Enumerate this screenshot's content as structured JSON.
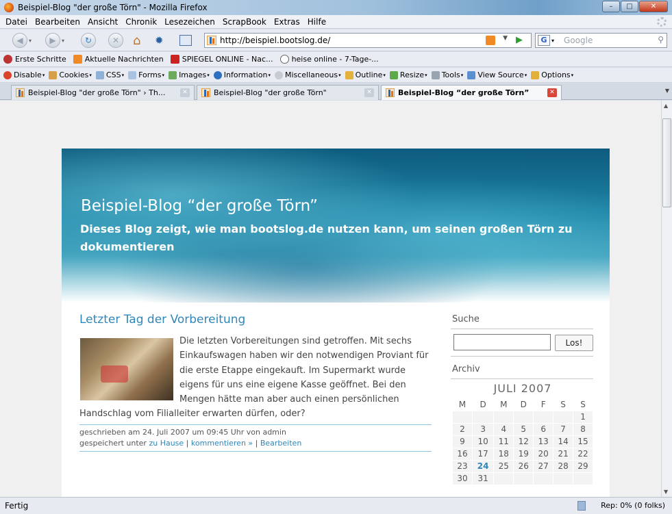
{
  "window": {
    "title": "Beispiel-Blog \"der große Törn\" - Mozilla Firefox"
  },
  "menu": [
    "Datei",
    "Bearbeiten",
    "Ansicht",
    "Chronik",
    "Lesezeichen",
    "ScrapBook",
    "Extras",
    "Hilfe"
  ],
  "nav": {
    "url": "http://beispiel.bootslog.de/",
    "search_placeholder": "Google"
  },
  "bookmarks": [
    "Erste Schritte",
    "Aktuelle Nachrichten",
    "SPIEGEL ONLINE - Nac...",
    "heise online - 7-Tage-..."
  ],
  "devtools": [
    "Disable",
    "Cookies",
    "CSS",
    "Forms",
    "Images",
    "Information",
    "Miscellaneous",
    "Outline",
    "Resize",
    "Tools",
    "View Source",
    "Options"
  ],
  "tabs": [
    {
      "label": "Beispiel-Blog \"der große Törn\" › Th..."
    },
    {
      "label": "Beispiel-Blog \"der große Törn\""
    },
    {
      "label": "Beispiel-Blog “der große Törn”"
    }
  ],
  "blog": {
    "title": "Beispiel-Blog “der große Törn”",
    "description": "Dieses Blog zeigt, wie man bootslog.de nutzen kann, um seinen großen Törn zu dokumentieren"
  },
  "post": {
    "title": "Letzter Tag der Vorbereitung",
    "body": "Die letzten Vorbereitungen sind getroffen. Mit sechs Einkaufswagen haben wir den notwendigen Proviant für die erste Etappe eingekauft. Im Supermarkt wurde eigens für uns eine eigene Kasse geöffnet. Bei den Mengen hätte man aber auch einen persönlichen Handschlag vom Filialleiter erwarten dürfen, oder?",
    "meta_written": "geschrieben am 24. Juli 2007 um 09:45 Uhr von admin",
    "meta_saved_prefix": "gespeichert unter",
    "category": "zu Hause",
    "comment": "kommentieren »",
    "edit": "Bearbeiten"
  },
  "sidebar": {
    "search_heading": "Suche",
    "search_button": "Los!",
    "archive_heading": "Archiv",
    "calendar": {
      "caption": "JULI 2007",
      "weekdays": [
        "M",
        "D",
        "M",
        "D",
        "F",
        "S",
        "S"
      ],
      "weeks": [
        [
          "",
          "",
          "",
          "",
          "",
          "",
          "1"
        ],
        [
          "2",
          "3",
          "4",
          "5",
          "6",
          "7",
          "8"
        ],
        [
          "9",
          "10",
          "11",
          "12",
          "13",
          "14",
          "15"
        ],
        [
          "16",
          "17",
          "18",
          "19",
          "20",
          "21",
          "22"
        ],
        [
          "23",
          "24",
          "25",
          "26",
          "27",
          "28",
          "29"
        ],
        [
          "30",
          "31",
          "",
          "",
          "",
          "",
          ""
        ]
      ],
      "highlight": "24"
    }
  },
  "status": {
    "left": "Fertig",
    "right": "Rep: 0% (0 folks)"
  }
}
